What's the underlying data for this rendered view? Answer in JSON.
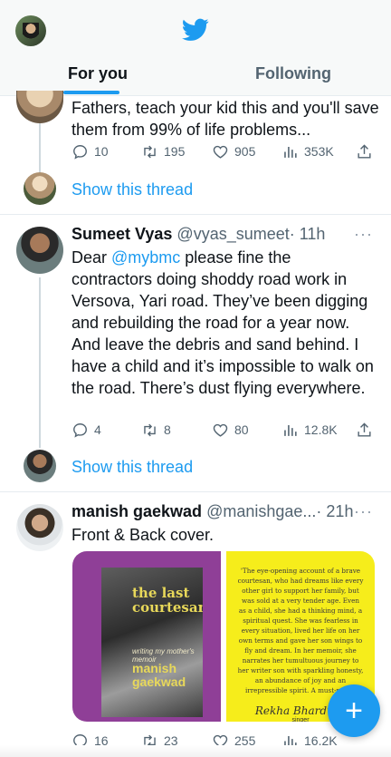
{
  "header": {
    "tabs": [
      {
        "label": "For you",
        "active": true
      },
      {
        "label": "Following",
        "active": false
      }
    ],
    "accent": "#1d9bf0"
  },
  "tweets": [
    {
      "text": "Fathers, teach your kid this and you'll save them from 99% of life problems...",
      "stats": {
        "replies": "10",
        "retweets": "195",
        "likes": "905",
        "views": "353K"
      },
      "show_thread": "Show this thread"
    },
    {
      "name": "Sumeet Vyas",
      "handle": "@vyas_sumeet",
      "time": "· 11h",
      "text_prefix": "Dear ",
      "mention": "@mybmc",
      "text_suffix": " please fine the contractors doing shoddy road work in Versova, Yari road. They’ve been digging and rebuilding the road for a year now. And leave the debris and sand behind. I have a child and it’s impossible to walk on the road. There’s dust flying everywhere.",
      "stats": {
        "replies": "4",
        "retweets": "8",
        "likes": "80",
        "views": "12.8K"
      },
      "show_thread": "Show this thread"
    },
    {
      "name": "manish gaekwad",
      "handle": "@manishgae...",
      "time": "· 21h",
      "text": "Front & Back cover.",
      "book": {
        "title": "the last courtesan",
        "subtitle": "writing my mother's memoir",
        "author": "manish gaekwad",
        "quote": "'The eye-opening account of a brave courtesan, who had dreams like every other girl to support her family, but was sold at a very tender age. Even as a child, she had a thinking mind, a spiritual quest. She was fearless in every situation, lived her life on her own terms and gave her son wings to fly and dream. In her memoir, she narrates her tumultuous journey to her writer son with sparkling honesty, an abundance of joy and an irrepressible spirit. A must-read!'",
        "signature": "Rekha Bhardwaj",
        "signature_role": "singer"
      },
      "stats": {
        "replies": "16",
        "retweets": "23",
        "likes": "255",
        "views": "16.2K"
      }
    }
  ],
  "more_label": "···",
  "fab_label": "+"
}
